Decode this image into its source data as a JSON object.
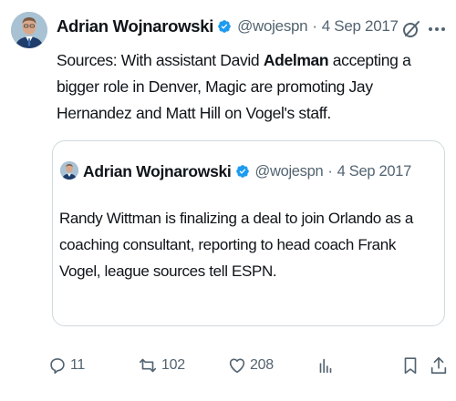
{
  "tweet": {
    "author_name": "Adrian Wojnarowski",
    "handle": "@wojespn",
    "separator": "·",
    "date": "4 Sep 2017",
    "text_before": "Sources: With assistant David ",
    "text_bold": "Adelman",
    "text_after": " accepting a bigger role in Denver, Magic are promoting Jay Hernandez and Matt Hill on Vogel's staff."
  },
  "quoted_tweet": {
    "author_name": "Adrian Wojnarowski",
    "handle": "@wojespn",
    "separator": "·",
    "date": "4 Sep 2017",
    "text": "Randy Wittman is finalizing a deal to join Orlando as a coaching consultant, reporting to head coach Frank Vogel, league sources tell ESPN."
  },
  "actions": {
    "replies": "11",
    "reposts": "102",
    "likes": "208"
  },
  "colors": {
    "verified_badge": "#1d9bf0",
    "secondary_text": "#536471",
    "card_border": "#cfd9de"
  },
  "icons": [
    "verified-badge-icon",
    "grok-icon",
    "more-icon",
    "reply-icon",
    "repost-icon",
    "like-icon",
    "views-icon",
    "bookmark-icon",
    "share-icon"
  ]
}
